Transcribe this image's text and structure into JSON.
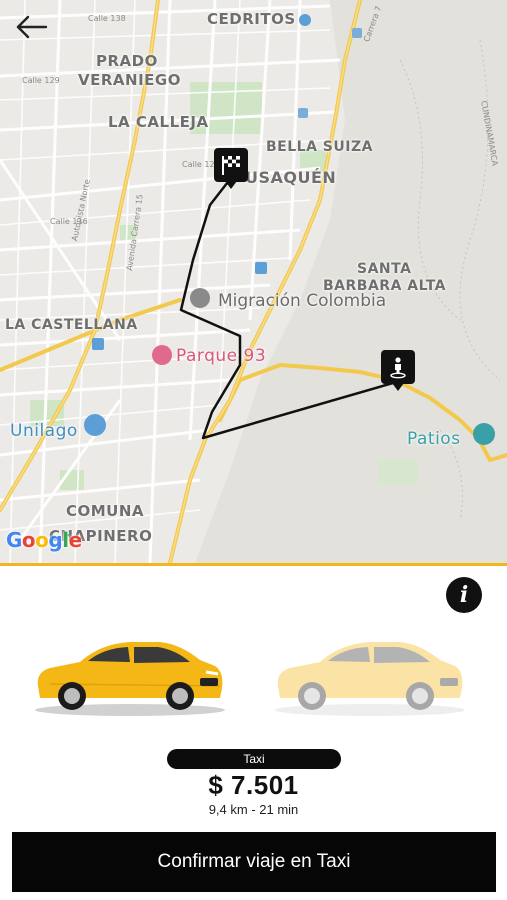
{
  "map": {
    "labels": {
      "cedritos": "CEDRITOS",
      "prado": "PRADO",
      "veraniego": "VERANIEGO",
      "la_calleja": "LA CALLEJA",
      "bella_suiza": "BELLA SUIZA",
      "usaquen": "USAQUÉN",
      "santa": "SANTA",
      "barbara_alta": "BARBARA ALTA",
      "la_castellana": "LA CASTELLANA",
      "comuna": "COMUNA",
      "chapinero": "CHAPINERO",
      "migracion": "Migración Colombia",
      "parque93": "Parque 93",
      "unilago": "Unilago",
      "patios": "Patios",
      "calle138": "Calle 138",
      "calle129": "Calle 129",
      "calle122": "Calle 122",
      "calle116": "Calle 116",
      "autopista_norte": "Autopista Norte",
      "avenida_carrera": "Avenida Carrera 15",
      "carrera7": "Carrera 7",
      "cundinamarca": "CUNDINAMARCA"
    },
    "google": {
      "g1": "G",
      "o1": "o",
      "o2": "o",
      "g2": "g",
      "l": "l",
      "e": "e"
    },
    "colors": {
      "route": "#111111",
      "major_road": "#f2c94c",
      "park": "#cfe5c6"
    }
  },
  "panel": {
    "accent_color": "#f2b51b",
    "vehicle_label": "Taxi",
    "price": "$ 7.501",
    "trip_meta": "9,4 km - 21 min",
    "confirm_label": "Confirmar viaje en Taxi",
    "info_icon": "i"
  }
}
